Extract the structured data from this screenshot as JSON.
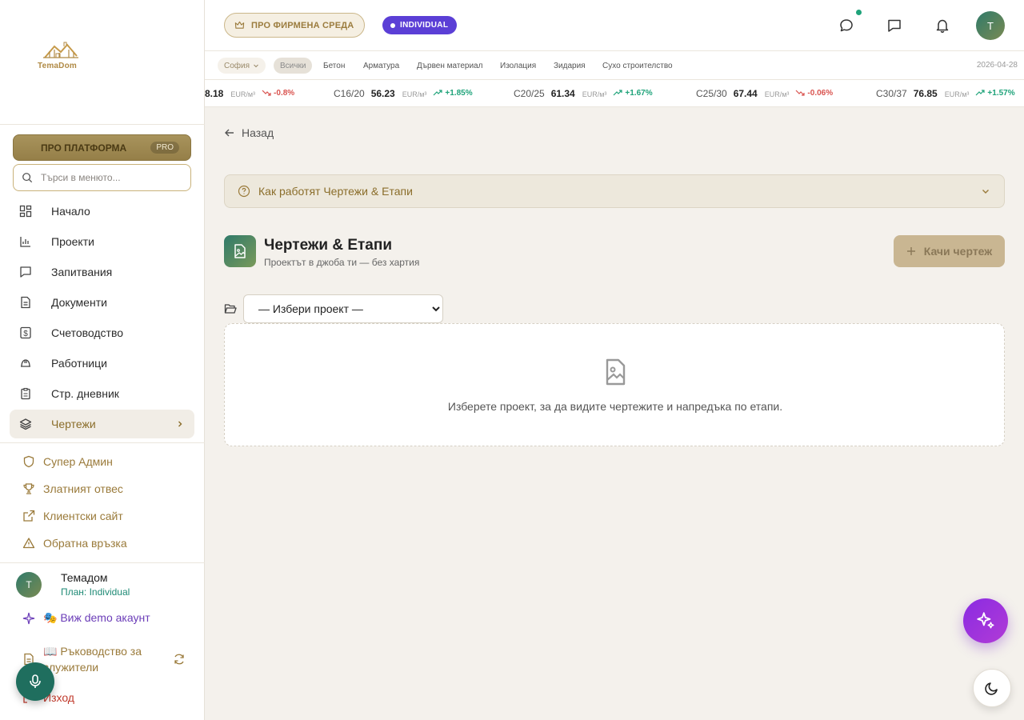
{
  "brand": {
    "name": "TemaDom"
  },
  "sidebar": {
    "pro_platform": {
      "label": "ПРО ПЛАТФОРМА",
      "tag": "PRO"
    },
    "search": {
      "placeholder": "Търси в менюто..."
    },
    "items": [
      {
        "label": "Начало",
        "icon": "dashboard-icon"
      },
      {
        "label": "Проекти",
        "icon": "chart-icon"
      },
      {
        "label": "Запитвания",
        "icon": "message-icon"
      },
      {
        "label": "Документи",
        "icon": "document-icon"
      },
      {
        "label": "Счетоводство",
        "icon": "dollar-icon"
      },
      {
        "label": "Работници",
        "icon": "hardhat-icon"
      },
      {
        "label": "Стр. дневник",
        "icon": "clipboard-icon"
      },
      {
        "label": "Чертежи",
        "icon": "layers-icon",
        "active": true
      }
    ],
    "secondary": [
      {
        "label": "Супер Админ",
        "icon": "shield-icon"
      },
      {
        "label": "Златният отвес",
        "icon": "trophy-icon"
      },
      {
        "label": "Клиентски сайт",
        "icon": "external-link-icon"
      },
      {
        "label": "Обратна връзка",
        "icon": "alert-triangle-icon"
      }
    ],
    "user": {
      "initial": "T",
      "name": "Темадом",
      "plan": "План: Individual"
    },
    "demo_label": "🎭 Виж demo акаунт",
    "guide_label": "📖 Ръководство за служители",
    "logout_label": "Изход"
  },
  "header": {
    "pro_env_label": "ПРО ФИРМЕНА СРЕДА",
    "plan_badge": "INDIVIDUAL",
    "avatar_initial": "T"
  },
  "filters": {
    "city": "София",
    "categories": [
      "Всички",
      "Бетон",
      "Арматура",
      "Дървен материал",
      "Изолация",
      "Зидария",
      "Сухо строителство"
    ],
    "date": "2026-04-28"
  },
  "ticker": [
    {
      "name": "",
      "value": "8.18",
      "unit": "EUR/м³",
      "change": "-0.8%",
      "direction": "down"
    },
    {
      "name": "C16/20",
      "value": "56.23",
      "unit": "EUR/м³",
      "change": "+1.85%",
      "direction": "up"
    },
    {
      "name": "C20/25",
      "value": "61.34",
      "unit": "EUR/м³",
      "change": "+1.67%",
      "direction": "up"
    },
    {
      "name": "C25/30",
      "value": "67.44",
      "unit": "EUR/м³",
      "change": "-0.06%",
      "direction": "down"
    },
    {
      "name": "C30/37",
      "value": "76.85",
      "unit": "EUR/м³",
      "change": "+1.57%",
      "direction": "up"
    }
  ],
  "main": {
    "back_label": "Назад",
    "howto_label": "Как работят Чертежи & Етапи",
    "title": "Чертежи & Етапи",
    "subtitle": "Проектът в джоба ти — без хартия",
    "upload_label": "Качи чертеж",
    "project_select": {
      "selected": "— Избери проект —"
    },
    "empty_text": "Изберете проект, за да видите чертежите и напредъка по етапи."
  }
}
